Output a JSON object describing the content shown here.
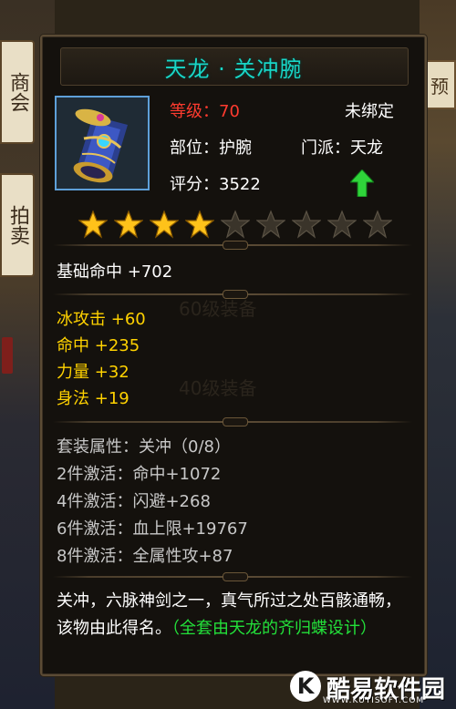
{
  "background": {
    "shop_signs": [
      "商会",
      "拍卖"
    ],
    "preview_tab": "预"
  },
  "item": {
    "title": "天龙 · 关冲腕",
    "level_label": "等级：",
    "level_value": "70",
    "binding": "未绑定",
    "slot": "部位：护腕",
    "sect": "门派：天龙",
    "score": "评分：3522",
    "upgrade_indicator": "arrow-up-green",
    "stars": {
      "filled": 4,
      "total": 9
    },
    "colors": {
      "title": "#19d6c7",
      "level": "#ff3b2f",
      "stat": "#ffd200",
      "set_desc": "#23e03a",
      "icon_border": "#5ea0d9"
    }
  },
  "base_stat": {
    "name": "基础命中",
    "value": "+702"
  },
  "stats": [
    {
      "name": "冰攻击",
      "value": "+60"
    },
    {
      "name": "命中",
      "value": "+235"
    },
    {
      "name": "力量",
      "value": "+32"
    },
    {
      "name": "身法",
      "value": "+19"
    }
  ],
  "ghost_text": [
    "60级装备",
    "40级装备"
  ],
  "set_bonus": {
    "header": "套装属性：关冲（0/8）",
    "lines": [
      "2件激活：命中+1072",
      "4件激活：闪避+268",
      "6件激活：血上限+19767",
      "8件激活：全属性攻+87"
    ]
  },
  "description": {
    "text": "关冲，六脉神剑之一，真气所过之处百骸通畅，该物由此得名。",
    "highlight": "（全套由天龙的齐归蝶设计）"
  },
  "watermark": {
    "logo_letter": "K",
    "text": "酷易软件园",
    "sub": "WWW.KUYISOFT.COM"
  }
}
